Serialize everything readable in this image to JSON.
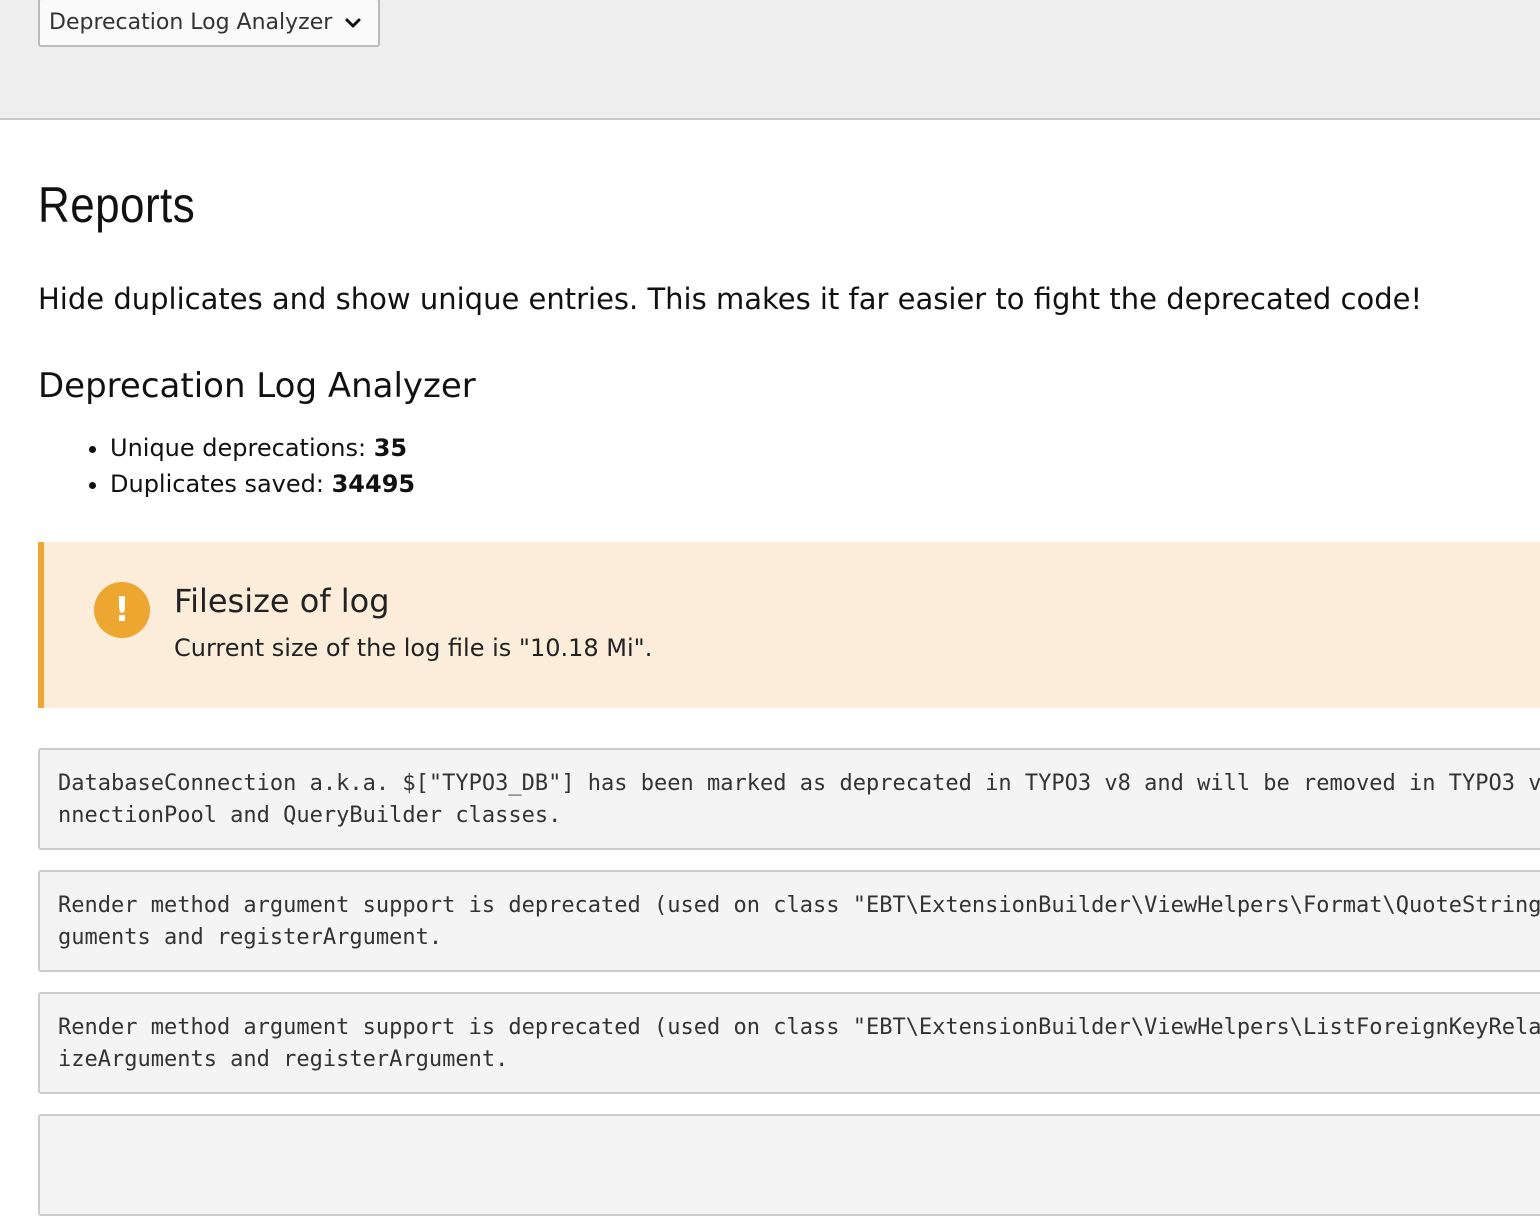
{
  "module_select": {
    "value": "Deprecation Log Analyzer",
    "icon": "chevron-down-icon"
  },
  "page": {
    "title": "Reports",
    "intro": "Hide duplicates and show unique entries. This makes it far easier to fight the deprecated code!"
  },
  "analyzer": {
    "title": "Deprecation Log Analyzer",
    "stats": [
      {
        "label": "Unique deprecations: ",
        "value": "35"
      },
      {
        "label": "Duplicates saved: ",
        "value": "34495"
      }
    ]
  },
  "callout": {
    "icon": "exclamation-icon",
    "glyph": "!",
    "title": "Filesize of log",
    "body": "Current size of the log file is \"10.18 Mi\".",
    "accent_color": "#f0a637",
    "background_color": "#fbedd9"
  },
  "entries": [
    {
      "line1": "DatabaseConnection a.k.a. $[\"TYPO3_DB\"] has been marked as deprecated in TYPO3 v8 and will be removed in TYPO3 v",
      "line2": "nnectionPool and QueryBuilder classes."
    },
    {
      "line1": "Render method argument support is deprecated (used on class \"EBT\\ExtensionBuilder\\ViewHelpers\\Format\\QuoteString",
      "line2": "guments and registerArgument."
    },
    {
      "line1": "Render method argument support is deprecated (used on class \"EBT\\ExtensionBuilder\\ViewHelpers\\ListForeignKeyRela",
      "line2": "izeArguments and registerArgument."
    }
  ]
}
